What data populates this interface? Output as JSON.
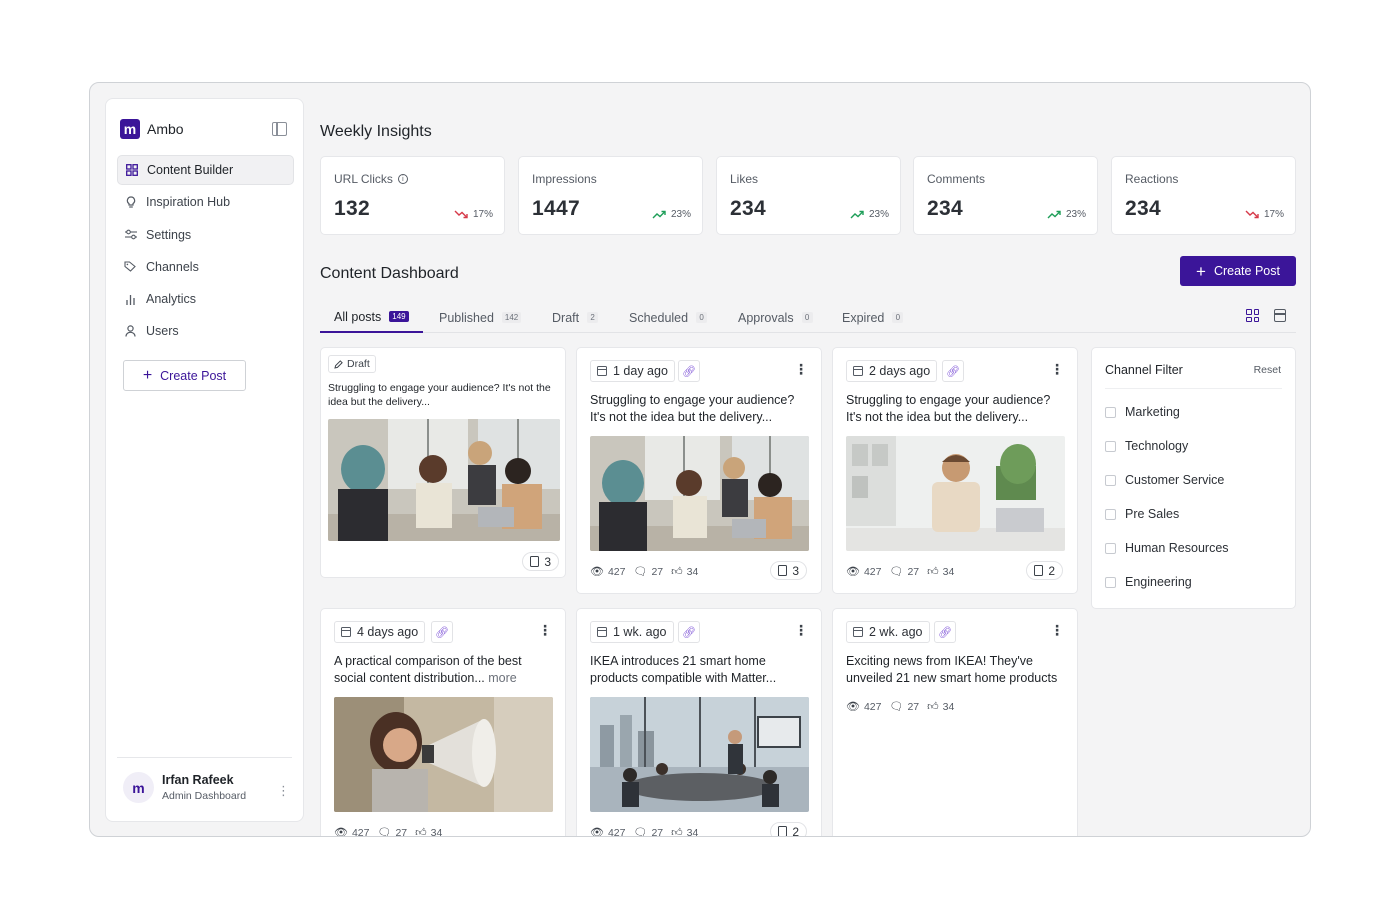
{
  "app": {
    "name": "Ambo",
    "logo_letter": "m"
  },
  "sidebar": {
    "items": [
      {
        "label": "Content Builder",
        "icon": "grid-icon",
        "active": true
      },
      {
        "label": "Inspiration Hub",
        "icon": "lightbulb-icon"
      },
      {
        "label": "Settings",
        "icon": "sliders-icon"
      },
      {
        "label": "Channels",
        "icon": "tags-icon"
      },
      {
        "label": "Analytics",
        "icon": "bar-chart-icon"
      },
      {
        "label": "Users",
        "icon": "user-icon"
      }
    ],
    "create_label": "Create Post",
    "user": {
      "name": "Irfan Rafeek",
      "role": "Admin Dashboard",
      "avatar_letter": "m"
    }
  },
  "insights": {
    "title": "Weekly Insights",
    "cards": [
      {
        "label": "URL Clicks",
        "value": "132",
        "trend": "17%",
        "direction": "down"
      },
      {
        "label": "Impressions",
        "value": "1447",
        "trend": "23%",
        "direction": "up"
      },
      {
        "label": "Likes",
        "value": "234",
        "trend": "23%",
        "direction": "up"
      },
      {
        "label": "Comments",
        "value": "234",
        "trend": "23%",
        "direction": "up"
      },
      {
        "label": "Reactions",
        "value": "234",
        "trend": "17%",
        "direction": "down"
      }
    ]
  },
  "dashboard": {
    "title": "Content Dashboard",
    "create_label": "Create Post",
    "tabs": [
      {
        "label": "All posts",
        "count": "149",
        "active": true
      },
      {
        "label": "Published",
        "count": "142"
      },
      {
        "label": "Draft",
        "count": "2"
      },
      {
        "label": "Scheduled",
        "count": "0"
      },
      {
        "label": "Approvals",
        "count": "0"
      },
      {
        "label": "Expired",
        "count": "0"
      }
    ]
  },
  "posts": [
    {
      "badge": "Draft",
      "text": "Struggling to engage your audience? It's not the idea but the delivery...",
      "copies": "3"
    },
    {
      "date": "1 day ago",
      "text": "Struggling to engage your audience? It's not the idea but the delivery...",
      "views": "427",
      "comments": "27",
      "likes": "34",
      "copies": "3"
    },
    {
      "date": "2 days ago",
      "text": "Struggling to engage your audience? It's not the idea but the delivery...",
      "views": "427",
      "comments": "27",
      "likes": "34",
      "copies": "2"
    },
    {
      "date": "4 days ago",
      "text": "A practical comparison of the best social content distribution...",
      "more": "more",
      "views": "427",
      "comments": "27",
      "likes": "34"
    },
    {
      "date": "1 wk. ago",
      "text": "IKEA introduces 21 smart home products compatible with Matter...",
      "views": "427",
      "comments": "27",
      "likes": "34",
      "copies": "2"
    },
    {
      "date": "2 wk. ago",
      "text": "Exciting news from IKEA! They've unveiled 21 new smart home products",
      "views": "427",
      "comments": "27",
      "likes": "34"
    }
  ],
  "filter": {
    "title": "Channel Filter",
    "reset_label": "Reset",
    "options": [
      "Marketing",
      "Technology",
      "Customer Service",
      "Pre Sales",
      "Human Resources",
      "Engineering"
    ]
  },
  "colors": {
    "brand": "#3b1599",
    "trend_up": "#1e9e58",
    "trend_down": "#d63a4a",
    "link": "#7b4fd6"
  }
}
